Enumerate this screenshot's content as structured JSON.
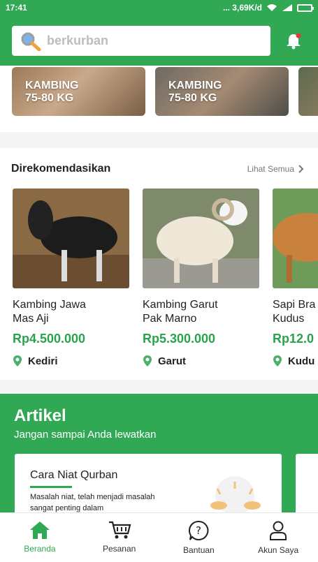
{
  "status_bar": {
    "time": "17:41",
    "network": "... 3,69K/d"
  },
  "search": {
    "placeholder": "berkurban"
  },
  "categories": [
    {
      "label": "KAMBING\n75-80 KG"
    },
    {
      "label": "KAMBING\n75-80 KG"
    }
  ],
  "recommended": {
    "title": "Direkomendasikan",
    "see_all": "Lihat Semua",
    "items": [
      {
        "name": "Kambing Jawa\nMas Aji",
        "price": "Rp4.500.000",
        "location": "Kediri"
      },
      {
        "name": "Kambing Garut\nPak Marno",
        "price": "Rp5.300.000",
        "location": "Garut"
      },
      {
        "name": "Sapi Bra\nKudus",
        "price": "Rp12.0",
        "location": "Kudu"
      }
    ]
  },
  "article": {
    "title": "Artikel",
    "subtitle": "Jangan sampai Anda lewatkan",
    "card_title": "Cara Niat Qurban",
    "card_desc": "Masalah niat, telah menjadi masalah sangat penting dalam"
  },
  "nav": [
    {
      "label": "Beranda",
      "icon": "home-icon"
    },
    {
      "label": "Pesanan",
      "icon": "cart-icon"
    },
    {
      "label": "Bantuan",
      "icon": "help-icon"
    },
    {
      "label": "Akun Saya",
      "icon": "user-icon"
    }
  ],
  "colors": {
    "primary": "#31a853",
    "price": "#2aa24d"
  }
}
